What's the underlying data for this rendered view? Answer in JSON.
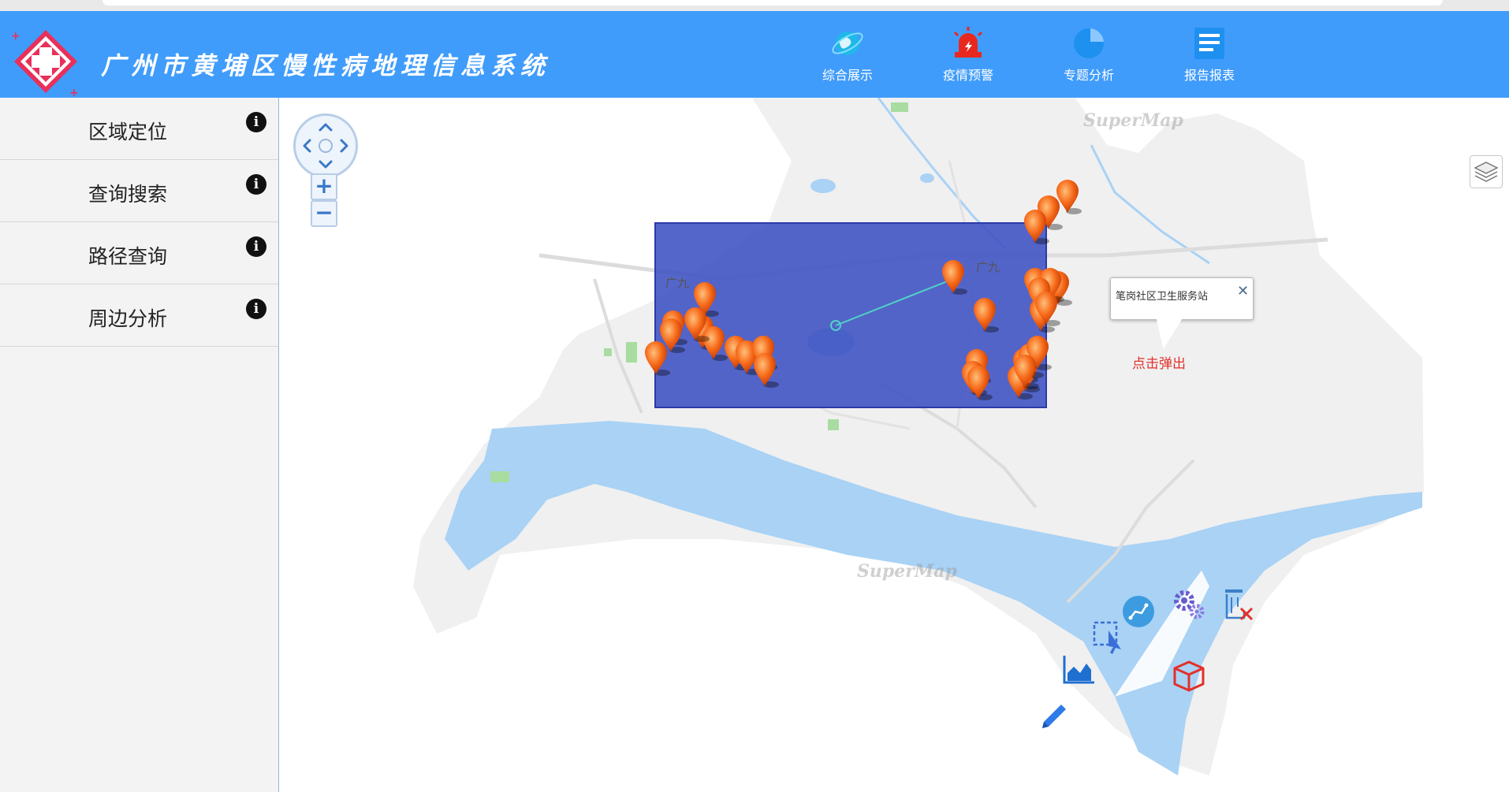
{
  "header": {
    "title": "广州市黄埔区慢性病地理信息系统",
    "logo_icon": "red-cross-icon",
    "nav": [
      {
        "label": "综合展示",
        "icon": "globe-icon",
        "color": "#1fb8e8"
      },
      {
        "label": "疫情预警",
        "icon": "alarm-siren-icon",
        "color": "#e8281f"
      },
      {
        "label": "专题分析",
        "icon": "pie-chart-icon",
        "color": "#1e90f0"
      },
      {
        "label": "报告报表",
        "icon": "report-icon",
        "color": "#1e90f0"
      }
    ]
  },
  "sidebar": {
    "items": [
      {
        "label": "区域定位",
        "icon": "info-icon"
      },
      {
        "label": "查询搜索",
        "icon": "info-icon"
      },
      {
        "label": "路径查询",
        "icon": "info-icon"
      },
      {
        "label": "周边分析",
        "icon": "info-icon"
      }
    ]
  },
  "map": {
    "watermark": "SuperMap",
    "road_label": "广九",
    "zoom_in_label": "+",
    "zoom_out_label": "−",
    "popup": {
      "title": "笔岗社区卫生服务站",
      "close_label": "✕",
      "link_text": "点击弹出"
    },
    "selection_color": "#3c4fc2",
    "tools": [
      "select-box-icon",
      "line-measure-icon",
      "settings-gears-icon",
      "clear-delete-icon",
      "area-chart-icon",
      "3d-box-icon",
      "pencil-icon"
    ],
    "markers": 36
  }
}
